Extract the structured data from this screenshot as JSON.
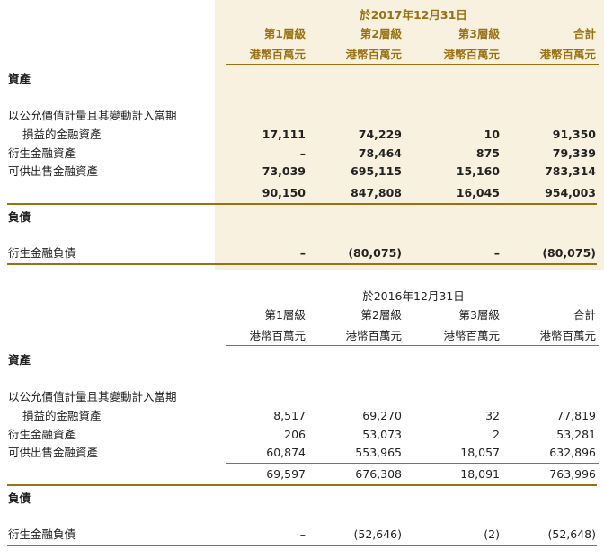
{
  "section_2017": {
    "date_heading": "於2017年12月31日",
    "columns": [
      {
        "label": "第1層級",
        "unit": "港幣百萬元"
      },
      {
        "label": "第2層級",
        "unit": "港幣百萬元"
      },
      {
        "label": "第3層級",
        "unit": "港幣百萬元"
      },
      {
        "label": "合計",
        "unit": "港幣百萬元"
      }
    ],
    "assets_heading": "資產",
    "fvtpl_line1": "以公允價值計量且其變動計入當期",
    "rows": [
      {
        "label": "損益的金融資產",
        "values": [
          "17,111",
          "74,229",
          "10",
          "91,350"
        ]
      },
      {
        "label": "衍生金融資產",
        "values": [
          "–",
          "78,464",
          "875",
          "79,339"
        ]
      },
      {
        "label": "可供出售金融資產",
        "values": [
          "73,039",
          "695,115",
          "15,160",
          "783,314"
        ]
      }
    ],
    "total": [
      "90,150",
      "847,808",
      "16,045",
      "954,003"
    ],
    "liabilities_heading": "負債",
    "liability_row": {
      "label": "衍生金融負債",
      "values": [
        "–",
        "(80,075)",
        "–",
        "(80,075)"
      ]
    }
  },
  "section_2016": {
    "date_heading": "於2016年12月31日",
    "columns": [
      {
        "label": "第1層級",
        "unit": "港幣百萬元"
      },
      {
        "label": "第2層級",
        "unit": "港幣百萬元"
      },
      {
        "label": "第3層級",
        "unit": "港幣百萬元"
      },
      {
        "label": "合計",
        "unit": "港幣百萬元"
      }
    ],
    "assets_heading": "資產",
    "fvtpl_line1": "以公允價值計量且其變動計入當期",
    "rows": [
      {
        "label": "損益的金融資產",
        "values": [
          "8,517",
          "69,270",
          "32",
          "77,819"
        ]
      },
      {
        "label": "衍生金融資產",
        "values": [
          "206",
          "53,073",
          "2",
          "53,281"
        ]
      },
      {
        "label": "可供出售金融資產",
        "values": [
          "60,874",
          "553,965",
          "18,057",
          "632,896"
        ]
      }
    ],
    "total": [
      "69,597",
      "676,308",
      "18,091",
      "763,996"
    ],
    "liabilities_heading": "負債",
    "liability_row": {
      "label": "衍生金融負債",
      "values": [
        "–",
        "(52,646)",
        "(2)",
        "(52,648)"
      ]
    }
  }
}
